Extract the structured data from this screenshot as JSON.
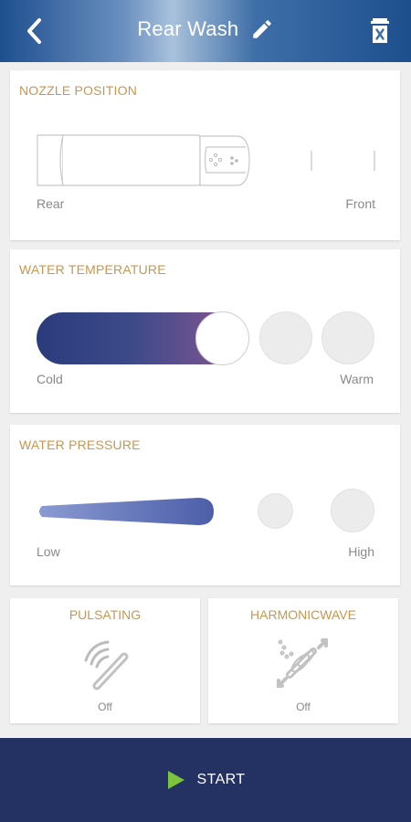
{
  "header": {
    "title": "Rear Wash"
  },
  "nozzle": {
    "title": "NOZZLE POSITION",
    "min_label": "Rear",
    "max_label": "Front",
    "level": 3,
    "levels": 5
  },
  "temperature": {
    "title": "WATER TEMPERATURE",
    "min_label": "Cold",
    "max_label": "Warm",
    "level": 3,
    "levels": 5
  },
  "pressure": {
    "title": "WATER PRESSURE",
    "min_label": "Low",
    "max_label": "High",
    "level": 3,
    "levels": 5
  },
  "pulsating": {
    "title": "PULSATING",
    "state": "Off",
    "icon": "pulsating-wave-icon"
  },
  "harmonic": {
    "title": "HARMONICWAVE",
    "state": "Off",
    "icon": "harmonicwave-icon"
  },
  "start": {
    "label": "START"
  },
  "colors": {
    "header": "#1e4f8f",
    "accent_title": "#c7974f",
    "start_bar": "#233163",
    "play": "#7cc43b",
    "temp_cold": "#2a3b7c",
    "temp_warm": "#8c5792",
    "pressure": "#5f70b8"
  }
}
